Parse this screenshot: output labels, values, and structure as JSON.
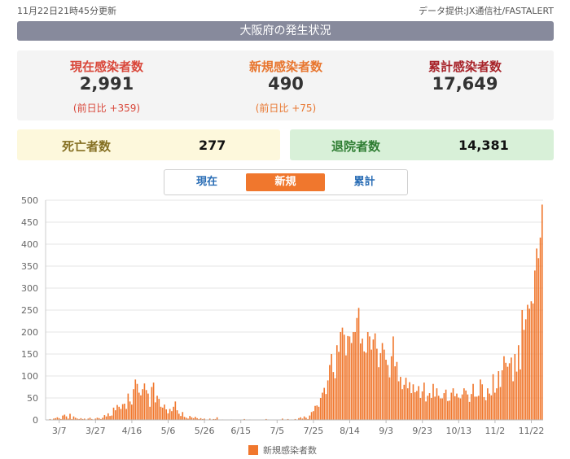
{
  "header": {
    "updated": "11月22日21時45分更新",
    "source": "データ提供:JX通信社/FASTALERT"
  },
  "title": "大阪府の発生状況",
  "stats": [
    {
      "label": "現在感染者数",
      "value": "2,991",
      "diff": "(前日比 +359)"
    },
    {
      "label": "新規感染者数",
      "value": "490",
      "diff": "(前日比 +75)"
    },
    {
      "label": "累計感染者数",
      "value": "17,649"
    }
  ],
  "deaths": {
    "label": "死亡者数",
    "value": "277"
  },
  "recovered": {
    "label": "退院者数",
    "value": "14,381"
  },
  "tabs": {
    "current": "現在",
    "new": "新規",
    "total": "累計"
  },
  "colors": {
    "bar": "#f0772d",
    "grid": "#e4e4e4"
  },
  "chart_data": {
    "type": "bar",
    "title": "",
    "xlabel": "",
    "ylabel": "",
    "ylim": [
      0,
      500
    ],
    "yticks": [
      0,
      50,
      100,
      150,
      200,
      250,
      300,
      350,
      400,
      450,
      500
    ],
    "xtick_labels": [
      "3/7",
      "3/27",
      "4/16",
      "5/6",
      "5/26",
      "6/15",
      "7/5",
      "7/25",
      "8/14",
      "9/3",
      "9/23",
      "10/13",
      "11/2",
      "11/22"
    ],
    "x_start": "2/29",
    "x_end": "11/22",
    "series": [
      {
        "name": "新規感染者数",
        "values": [
          0,
          0,
          2,
          0,
          3,
          4,
          6,
          4,
          2,
          10,
          12,
          8,
          3,
          14,
          2,
          8,
          5,
          3,
          2,
          4,
          2,
          3,
          1,
          3,
          5,
          2,
          1,
          3,
          5,
          4,
          2,
          5,
          11,
          8,
          15,
          9,
          10,
          28,
          22,
          34,
          30,
          25,
          36,
          37,
          25,
          60,
          42,
          35,
          70,
          92,
          82,
          62,
          56,
          70,
          83,
          68,
          60,
          30,
          75,
          85,
          40,
          55,
          48,
          30,
          28,
          35,
          24,
          15,
          25,
          20,
          30,
          42,
          22,
          14,
          9,
          18,
          7,
          5,
          3,
          9,
          6,
          4,
          7,
          4,
          2,
          4,
          2,
          3,
          0,
          1,
          3,
          0,
          2,
          2,
          6,
          1,
          0,
          1,
          0,
          0,
          0,
          0,
          1,
          0,
          0,
          0,
          0,
          0,
          0,
          2,
          0,
          0,
          1,
          0,
          0,
          0,
          0,
          0,
          0,
          0,
          0,
          2,
          1,
          0,
          0,
          0,
          0,
          0,
          0,
          1,
          3,
          0,
          1,
          2,
          0,
          1,
          0,
          2,
          0,
          4,
          6,
          3,
          8,
          5,
          2,
          10,
          18,
          20,
          32,
          33,
          30,
          50,
          62,
          73,
          59,
          90,
          125,
          150,
          109,
          95,
          170,
          155,
          200,
          210,
          194,
          147,
          191,
          190,
          175,
          200,
          200,
          232,
          255,
          174,
          185,
          156,
          153,
          200,
          190,
          160,
          183,
          197,
          162,
          120,
          152,
          175,
          160,
          137,
          125,
          97,
          145,
          190,
          122,
          132,
          88,
          98,
          70,
          80,
          96,
          72,
          86,
          61,
          81,
          63,
          66,
          77,
          50,
          65,
          85,
          42,
          55,
          61,
          50,
          82,
          53,
          72,
          55,
          49,
          49,
          61,
          69,
          43,
          44,
          62,
          72,
          54,
          60,
          51,
          49,
          58,
          72,
          67,
          58,
          41,
          59,
          82,
          53,
          53,
          55,
          92,
          81,
          52,
          45,
          72,
          60,
          56,
          104,
          62,
          72,
          111,
          75,
          113,
          145,
          130,
          121,
          129,
          142,
          88,
          150,
          110,
          170,
          115,
          250,
          205,
          229,
          262,
          253,
          270,
          265,
          340,
          390,
          368,
          415,
          490
        ]
      }
    ]
  }
}
